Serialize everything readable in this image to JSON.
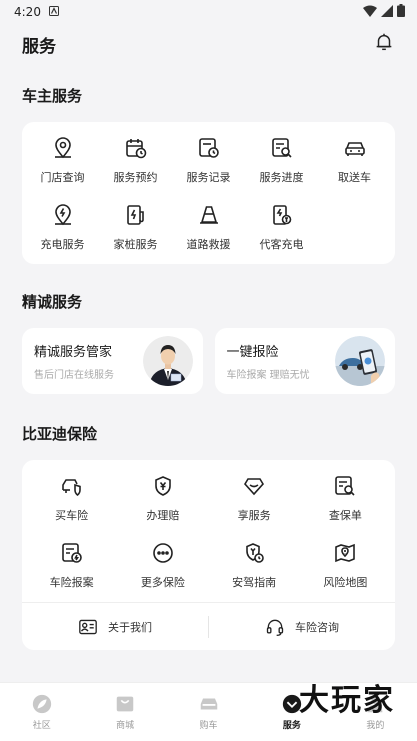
{
  "status": {
    "time": "4:20"
  },
  "header": {
    "title": "服务"
  },
  "owner": {
    "title": "车主服务",
    "items": [
      {
        "label": "门店查询",
        "icon": "location-pin-icon"
      },
      {
        "label": "服务预约",
        "icon": "calendar-clock-icon"
      },
      {
        "label": "服务记录",
        "icon": "document-clock-icon"
      },
      {
        "label": "服务进度",
        "icon": "document-search-icon"
      },
      {
        "label": "取送车",
        "icon": "car-icon"
      },
      {
        "label": "充电服务",
        "icon": "charging-pin-icon"
      },
      {
        "label": "家桩服务",
        "icon": "charging-pile-icon"
      },
      {
        "label": "道路救援",
        "icon": "traffic-cone-icon"
      },
      {
        "label": "代客充电",
        "icon": "valet-charge-icon"
      }
    ]
  },
  "premium": {
    "title": "精诚服务",
    "cards": [
      {
        "title": "精诚服务管家",
        "subtitle": "售后门店在线服务"
      },
      {
        "title": "一键报险",
        "subtitle": "车险报案 理赔无忧"
      }
    ]
  },
  "insurance": {
    "title": "比亚迪保险",
    "items": [
      {
        "label": "买车险",
        "icon": "car-shield-icon"
      },
      {
        "label": "办理赔",
        "icon": "yen-shield-icon"
      },
      {
        "label": "享服务",
        "icon": "diamond-icon"
      },
      {
        "label": "查保单",
        "icon": "policy-search-icon"
      },
      {
        "label": "车险报案",
        "icon": "report-clock-icon"
      },
      {
        "label": "更多保险",
        "icon": "more-icon"
      },
      {
        "label": "安驾指南",
        "icon": "shield-clock-icon"
      },
      {
        "label": "风险地图",
        "icon": "risk-map-icon"
      }
    ],
    "links": [
      {
        "label": "关于我们",
        "icon": "about-card-icon"
      },
      {
        "label": "车险咨询",
        "icon": "headset-icon"
      }
    ]
  },
  "tabbar": {
    "tabs": [
      {
        "label": "社区"
      },
      {
        "label": "商城"
      },
      {
        "label": "购车"
      },
      {
        "label": "服务"
      },
      {
        "label": "我的"
      }
    ]
  },
  "watermark": "大玩家"
}
